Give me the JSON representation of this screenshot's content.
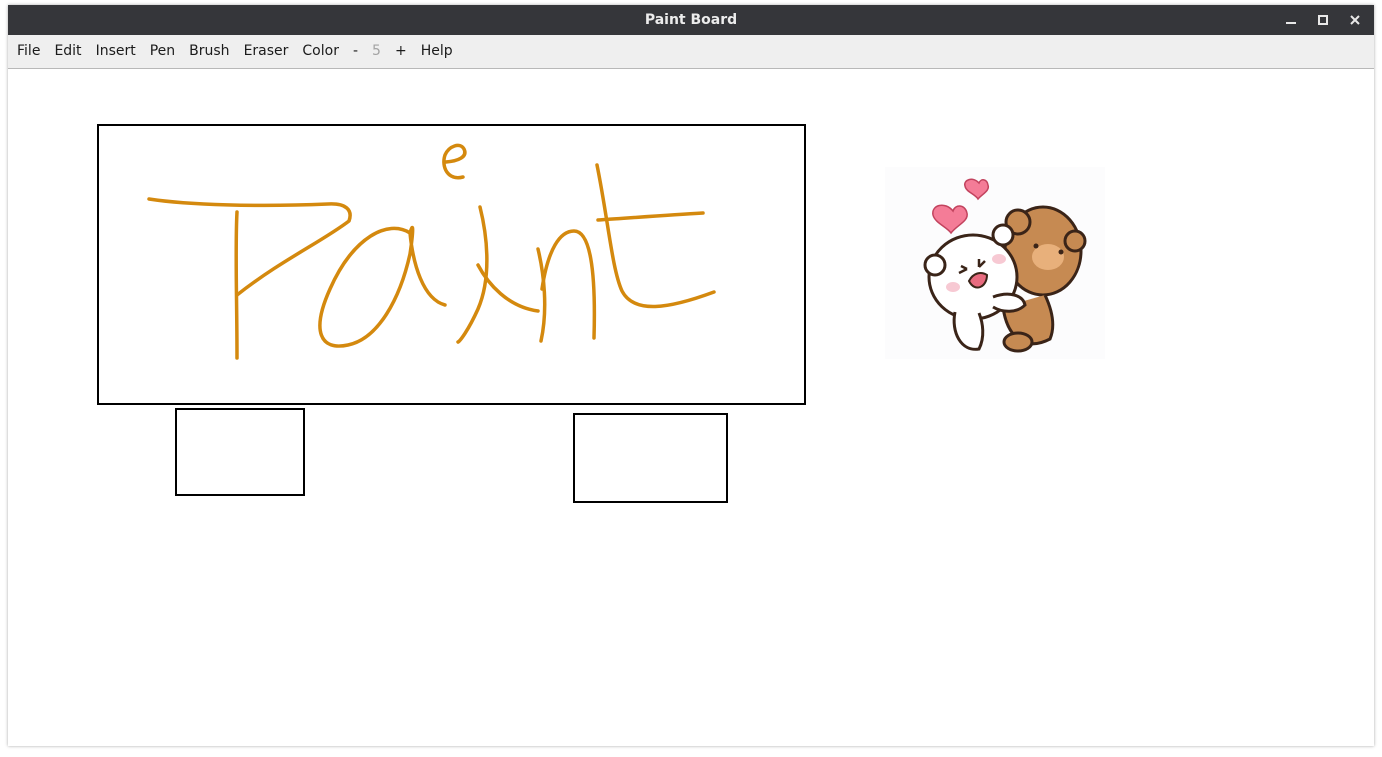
{
  "window": {
    "title": "Paint Board"
  },
  "window_controls": [
    {
      "name": "minimize-button",
      "icon": "minimize-icon"
    },
    {
      "name": "maximize-button",
      "icon": "maximize-icon"
    },
    {
      "name": "close-button",
      "icon": "close-icon"
    }
  ],
  "menu": {
    "file": "File",
    "edit": "Edit",
    "insert": "Insert",
    "pen": "Pen",
    "brush": "Brush",
    "eraser": "Eraser",
    "color": "Color",
    "decrease": "-",
    "size": "5",
    "increase": "+",
    "help": "Help"
  },
  "canvas": {
    "stroke_color": "#d4890e",
    "shape_border_color": "#000000",
    "handwriting_icon": "handwritten-paint-drawing",
    "sticker_icon": "hugging-bears-sticker"
  }
}
